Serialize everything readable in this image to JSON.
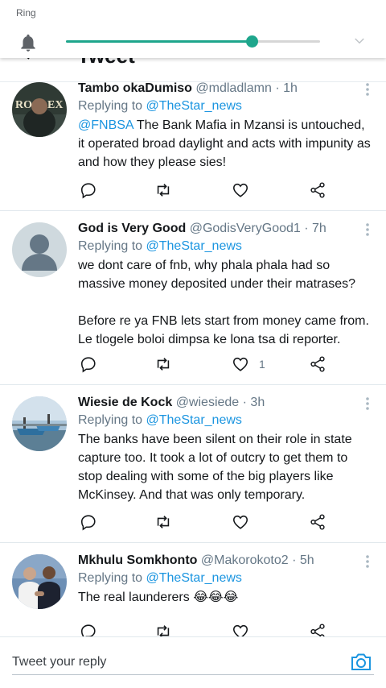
{
  "volume": {
    "label": "Ring",
    "level_fraction": 0.73
  },
  "header": {
    "title": "Tweet"
  },
  "colors": {
    "accent": "#1ea68c",
    "link": "#1b95e0",
    "muted": "#657786"
  },
  "tweets": [
    {
      "name": "Tambo okaDumiso",
      "handle": "@mdladlamn",
      "time": "· 1h",
      "replying_prefix": "Replying to ",
      "replying_to": "@TheStar_news",
      "body_mention": "@FNBSA",
      "body": " The Bank Mafia in Mzansi is untouched, it operated broad daylight and acts with impunity as and how they please sies!",
      "like_count": "",
      "avatar_icon": "rolex-avatar"
    },
    {
      "name": "God is Very Good",
      "handle": "@GodisVeryGood1",
      "time": "· 7h",
      "replying_prefix": "Replying to ",
      "replying_to": "@TheStar_news",
      "body_mention": "",
      "body": "we dont care of fnb, why phala phala had so massive money deposited under their matrases?\n\nBefore re ya FNB lets start from money came from. Le tlogele boloi dimpsa ke lona tsa di reporter.",
      "like_count": "1",
      "avatar_icon": "default-avatar"
    },
    {
      "name": "Wiesie de Kock",
      "handle": "@wiesiede",
      "time": "· 3h",
      "replying_prefix": "Replying to ",
      "replying_to": "@TheStar_news",
      "body_mention": "",
      "body": "The banks have been silent on their role in state capture too. It took a lot of outcry to get them to stop dealing with some of the big players like McKinsey. And that was only temporary.",
      "like_count": "",
      "avatar_icon": "boats-avatar"
    },
    {
      "name": "Mkhulu Somkhonto",
      "handle": "@Makorokoto2",
      "time": "· 5h",
      "replying_prefix": "Replying to ",
      "replying_to": "@TheStar_news",
      "body_mention": "",
      "body": "The real launderers 😂😂😂",
      "like_count": "",
      "avatar_icon": "handshake-avatar"
    }
  ],
  "reply_bar": {
    "placeholder": "Tweet your reply"
  }
}
